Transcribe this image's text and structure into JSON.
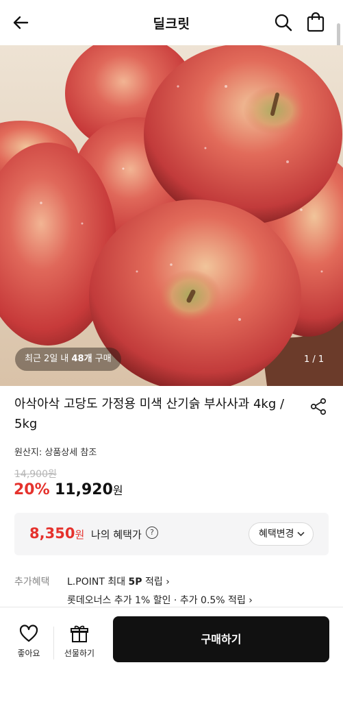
{
  "header": {
    "title": "딜크릿",
    "back_icon": "arrow-left-icon",
    "search_icon": "search-icon",
    "bag_icon": "shopping-bag-icon"
  },
  "hero": {
    "badge_prefix": "최근 2일 내 ",
    "badge_count": "48개",
    "badge_suffix": " 구매",
    "pager": "1 / 1"
  },
  "product": {
    "title": "아삭아삭 고당도 가정용 미색 산기슭 부사사과 4kg / 5kg",
    "origin": "원산지: 상품상세 참조",
    "original_price": "14,900원",
    "discount": "20%",
    "price": "11,920",
    "price_unit": "원",
    "share_icon": "share-icon"
  },
  "benefit": {
    "price": "8,350",
    "price_unit": "원",
    "label": "나의 혜택가",
    "help": "?",
    "change_label": "혜택변경"
  },
  "extra": {
    "label": "추가혜택",
    "line1_prefix": "L.POINT 최대 ",
    "line1_bold": "5P",
    "line1_suffix": " 적립 ›",
    "line2": "롯데오너스 추가 1% 할인 · 추가 0.5% 적립 ›"
  },
  "bottom": {
    "like_label": "좋아요",
    "gift_label": "선물하기",
    "buy_label": "구매하기"
  },
  "colors": {
    "accent_red": "#e5322d",
    "buy_button": "#111111",
    "benefit_bg": "#f5f5f6"
  }
}
